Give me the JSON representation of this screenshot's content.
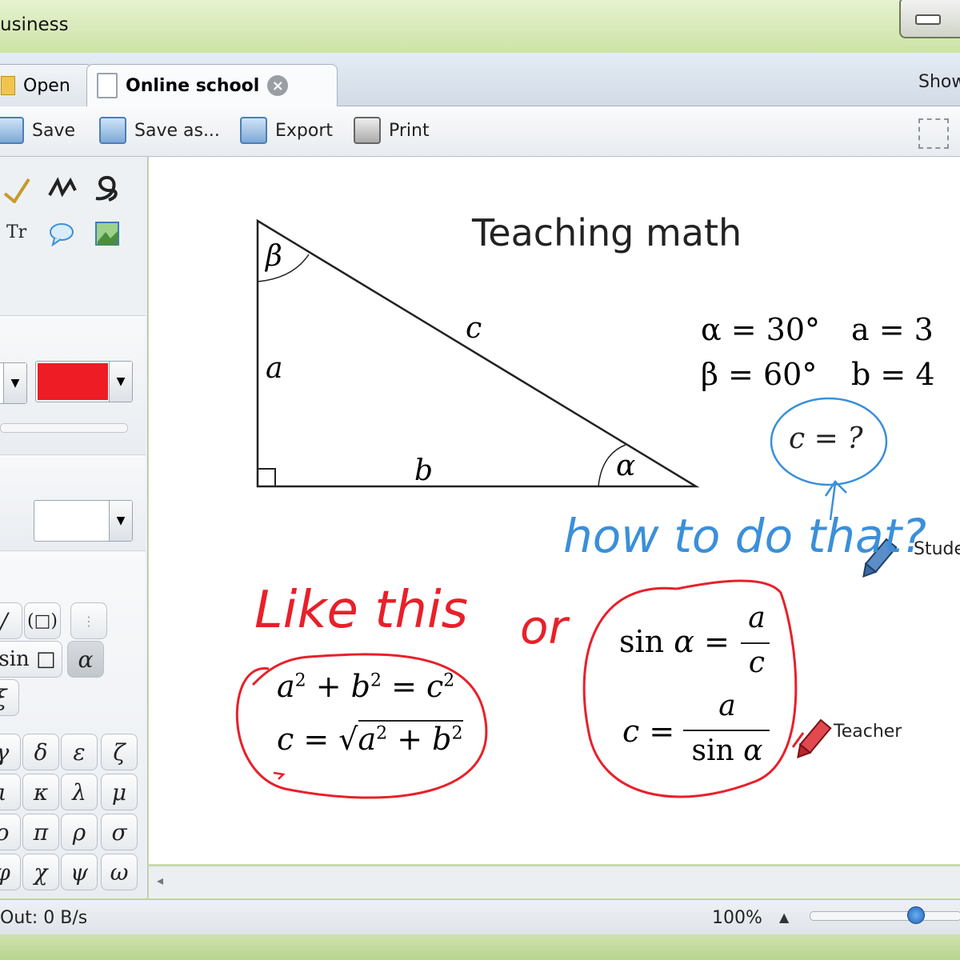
{
  "window": {
    "title": "usiness"
  },
  "tabs": {
    "open_label": "Open",
    "active_label": "Online school",
    "right_label": "Show"
  },
  "toolbar": {
    "save": "Save",
    "save_as": "Save as...",
    "export": "Export",
    "print": "Print"
  },
  "left_panel": {
    "text_tool": "Tr",
    "color_swatch": "#ee1c24",
    "symbols": [
      "sin",
      "α"
    ],
    "greek_rows": [
      [
        "γ",
        "δ",
        "ε",
        "ζ"
      ],
      [
        "ι",
        "κ",
        "λ",
        "μ"
      ],
      [
        "ο",
        "π",
        "ρ",
        "σ"
      ],
      [
        "φ",
        "χ",
        "ψ",
        "ω"
      ]
    ],
    "extra_symbol": "ξ"
  },
  "canvas": {
    "heading": "Teaching math",
    "triangle_labels": {
      "beta": "β",
      "c": "c",
      "a": "a",
      "b": "b",
      "alpha": "α"
    },
    "givens": {
      "alpha": "α = 30°",
      "a": "a = 3",
      "beta": "β = 60°",
      "b": "b = 4"
    },
    "question": "c = ?",
    "student_note": "how to do that?",
    "student_tag": "Stude",
    "teacher_note_1": "Like this",
    "teacher_note_2": "or",
    "teacher_tag": "Teacher",
    "colors": {
      "student": "#3b8fd9",
      "teacher": "#e8202a"
    }
  },
  "status": {
    "traffic": "Out: 0 B/s",
    "zoom": "100%"
  }
}
